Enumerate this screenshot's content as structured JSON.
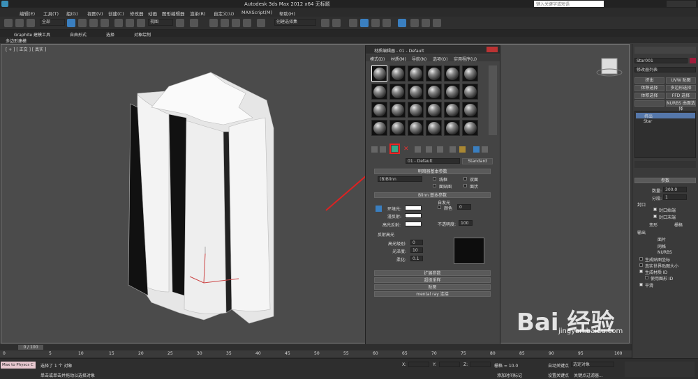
{
  "title": "Autodesk 3ds Max 2012 x64     无标题",
  "search_placeholder": "键入关键字或短语",
  "menus": [
    "编辑(E)",
    "工具(T)",
    "组(G)",
    "视图(V)",
    "创建(C)",
    "修改器",
    "动画",
    "图形编辑器",
    "渲染(R)",
    "自定义(U)",
    "MAXScript(M)",
    "帮助(H)"
  ],
  "toolbar": {
    "selection_filter": "全部",
    "ref_coord": "视图",
    "named_sel": "创建选择集"
  },
  "ribbon": {
    "tabs": [
      "Graphite 建模工具",
      "自由形式",
      "选择",
      "对象绘制"
    ],
    "sub": "多边形建模"
  },
  "viewport": {
    "label": "[ + ] [ 正交 ] [ 真实 ]"
  },
  "material_editor": {
    "title": "材质编辑器 - 01 - Default",
    "menus": [
      "模式(D)",
      "材质(M)",
      "导航(N)",
      "选项(O)",
      "实用程序(U)"
    ],
    "material_name": "01 - Default",
    "material_type": "Standard",
    "shader_rollout": "明暗器基本参数",
    "shader": "(B)Blinn",
    "shader_opts": [
      "线框",
      "双面",
      "面贴图",
      "面状"
    ],
    "blinn_rollout": "Blinn 基本参数",
    "self_illum": "自发光",
    "color_label": "颜色",
    "color_value": "0",
    "ambient": "环境光:",
    "diffuse": "漫反射:",
    "specular": "高光反射:",
    "opacity_label": "不透明度:",
    "opacity": "100",
    "spec_hl": "反射高光",
    "spec_level_label": "高光级别:",
    "spec_level": "0",
    "gloss_label": "光泽度:",
    "gloss": "10",
    "soften_label": "柔化:",
    "soften": "0.1",
    "rollouts": [
      "扩展参数",
      "超级采样",
      "贴图",
      "mental ray 连接"
    ]
  },
  "cmd": {
    "name": "Star001",
    "modlist": "修改器列表",
    "buttons": [
      "挤出",
      "UVW 贴图",
      "体积选择",
      "多边形选择",
      "体积选择",
      "FFD 选择",
      "",
      "NURBS 曲面选择"
    ],
    "stack": [
      "挤出",
      "Star"
    ],
    "params": "参数",
    "amount_label": "数量:",
    "amount": "300.0",
    "segs_label": "分段:",
    "segs": "1",
    "cap": "封口",
    "cap_start": "封口始端",
    "cap_end": "封口末端",
    "morph": "变形",
    "grid": "栅格",
    "output": "输出",
    "out_patch": "面片",
    "out_mesh": "网格",
    "out_nurbs": "NURBS",
    "gen_map": "生成贴图坐标",
    "real_world": "真实世界贴图大小",
    "gen_mat": "生成材质 ID",
    "use_shape": "使用图形 ID",
    "smooth": "平滑"
  },
  "timeline": {
    "frame": "0 / 100",
    "ticks": [
      "0",
      "5",
      "10",
      "15",
      "20",
      "25",
      "30",
      "35",
      "40",
      "45",
      "50",
      "55",
      "60",
      "65",
      "70",
      "75",
      "80",
      "85",
      "90",
      "95",
      "100"
    ]
  },
  "status": {
    "script": "Max to Physcs C",
    "msg1": "选择了 1 个 对象",
    "msg2": "单击或单击并拖动以选择对象",
    "x": "X:",
    "y": "Y:",
    "z": "Z:",
    "grid": "栅格 = 10.0",
    "add_time": "添加时间标记",
    "autokey": "自动关键点",
    "sel_obj": "选定对象",
    "setkey": "设置关键点",
    "filter": "关键点过滤器..."
  },
  "watermark": {
    "brand": "Bai 经验",
    "url": "jingyan.baidu.com"
  }
}
